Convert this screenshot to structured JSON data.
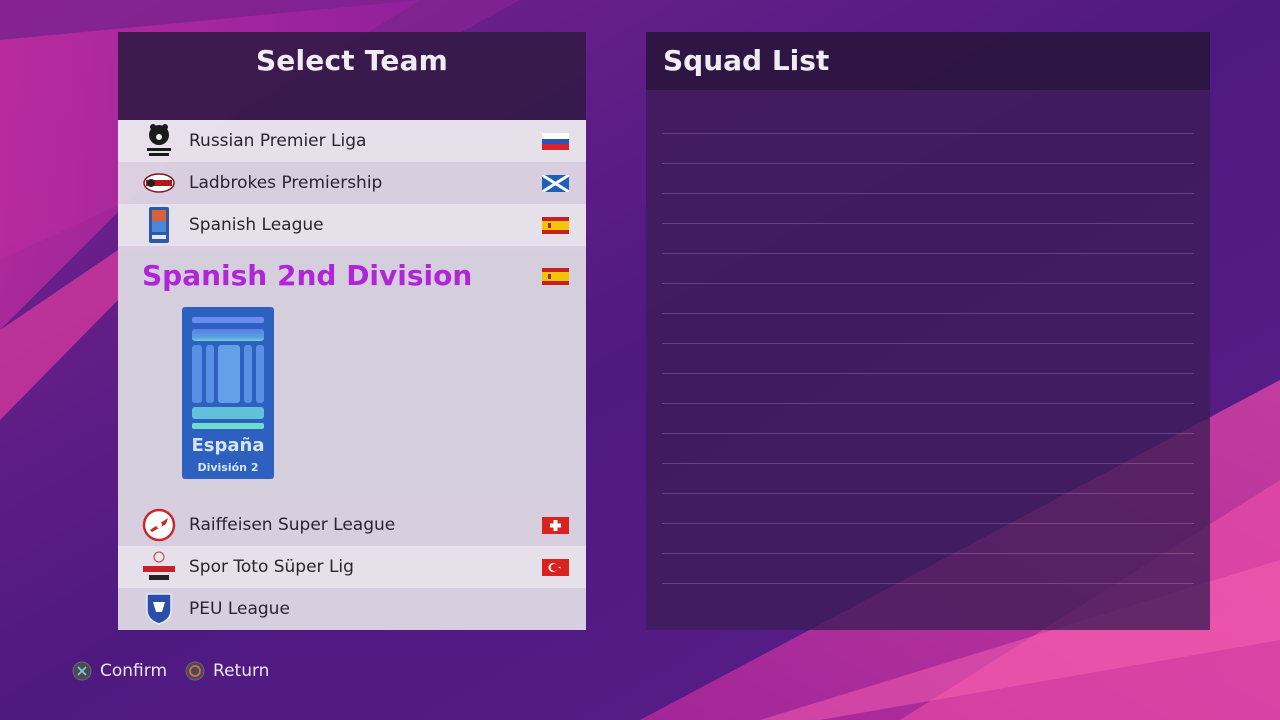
{
  "select_team": {
    "title": "Select Team",
    "leagues": [
      {
        "name": "Russian Premier Liga",
        "logo": "rpl-bear-logo-icon",
        "flag": "russia-flag-icon"
      },
      {
        "name": "Ladbrokes Premiership",
        "logo": "spfl-logo-icon",
        "flag": "scotland-flag-icon"
      },
      {
        "name": "Spanish League",
        "logo": "laliga-logo-icon",
        "flag": "spain-flag-icon"
      },
      {
        "name": "Spanish 2nd Division",
        "logo": "espana-division2-logo-icon",
        "flag": "spain-flag-icon",
        "selected": true,
        "logo_text": {
          "line1": "España",
          "line2": "División 2"
        }
      },
      {
        "name": "Raiffeisen Super League",
        "logo": "swiss-super-league-logo-icon",
        "flag": "switzerland-flag-icon"
      },
      {
        "name": "Spor Toto Süper Lig",
        "logo": "spor-toto-logo-icon",
        "flag": "turkey-flag-icon"
      },
      {
        "name": "PEU League",
        "logo": "peu-shield-logo-icon",
        "flag": null
      }
    ]
  },
  "squad_list": {
    "title": "Squad List",
    "rows": 16
  },
  "footer": {
    "confirm_label": "Confirm",
    "return_label": "Return",
    "confirm_icon": "cross-button-icon",
    "return_icon": "circle-button-icon"
  },
  "colors": {
    "selected_text": "#b026d6",
    "background_purple": "#5a1d86",
    "background_magenta": "#d02ab0"
  }
}
